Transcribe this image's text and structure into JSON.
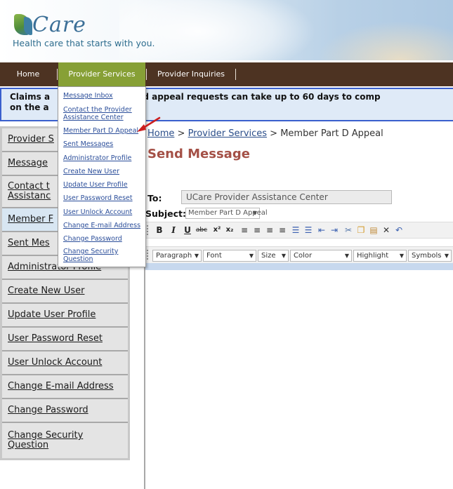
{
  "header": {
    "logo_letter": "U",
    "logo_text": "Care",
    "tagline": "Health care that starts with you."
  },
  "nav": {
    "home": "Home",
    "provider_services": "Provider Services",
    "provider_inquiries": "Provider Inquiries"
  },
  "notice": {
    "line1": "Claims a           d to approved appeal requests can take up to 60 days to comp",
    "line2": "on the a"
  },
  "sidebar": {
    "items": [
      {
        "label": "Provider S"
      },
      {
        "label": "Message"
      },
      {
        "label": "Contact t\nAssistanc"
      },
      {
        "label": "Member F"
      },
      {
        "label": "Sent Mes"
      },
      {
        "label": "Administrator Profile"
      },
      {
        "label": "Create New User"
      },
      {
        "label": "Update User Profile"
      },
      {
        "label": "User Password Reset"
      },
      {
        "label": "User Unlock Account"
      },
      {
        "label": "Change E-mail Address"
      },
      {
        "label": "Change Password"
      },
      {
        "label": "Change Security\nQuestion"
      }
    ]
  },
  "dropdown": {
    "items": [
      {
        "label": "Message Inbox"
      },
      {
        "label": "Contact the Provider Assistance Center"
      },
      {
        "label": "Member Part D Appeal"
      },
      {
        "label": "Sent Messages"
      },
      {
        "label": "Administrator Profile"
      },
      {
        "label": "Create New User"
      },
      {
        "label": "Update User Profile"
      },
      {
        "label": "User Password Reset"
      },
      {
        "label": "User Unlock Account"
      },
      {
        "label": "Change E-mail Address"
      },
      {
        "label": "Change Password"
      },
      {
        "label": "Change Security Question"
      }
    ]
  },
  "breadcrumb": {
    "home": "Home",
    "sep1": " > ",
    "provider_services": "Provider Services",
    "sep2": " > ",
    "current": "Member Part D Appeal"
  },
  "page": {
    "title": "Send Message",
    "to_label": "To:",
    "to_value": "UCare Provider Assistance Center",
    "subject_label": "Subject:",
    "subject_value": "Member Part D Appeal"
  },
  "editor": {
    "toolbar": {
      "bold": "B",
      "italic": "I",
      "underline": "U",
      "strike": "abc",
      "superscript": "x²",
      "subscript": "x₂",
      "align_left": "≡",
      "align_center": "≡",
      "align_right": "≡",
      "justify": "≡",
      "unordered_list": "☰",
      "ordered_list": "☰",
      "outdent": "⇤",
      "indent": "⇥",
      "cut": "✂",
      "copy": "❐",
      "paste": "▤",
      "delete": "✕",
      "undo": "↶"
    },
    "selects": {
      "paragraph": "Paragraph",
      "font": "Font",
      "size": "Size",
      "color": "Color",
      "highlight": "Highlight",
      "symbols": "Symbols"
    },
    "arrow": "▼"
  },
  "colors": {
    "nav_bg": "#4d3322",
    "nav_active": "#87a036",
    "title": "#a45046",
    "link": "#2b4e8a",
    "notice_border": "#3a5fcd",
    "pointer": "#cc1f1f"
  }
}
